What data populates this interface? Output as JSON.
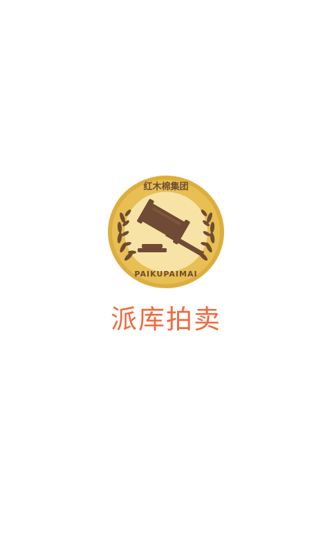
{
  "splash": {
    "logo": {
      "icon": "auction-gavel-icon",
      "top_text": "红木棉集团",
      "bottom_text": "PAIKUPAIMAI"
    },
    "app_name": "派库拍卖"
  },
  "colors": {
    "background": "#ffffff",
    "gold_outer": "#dcae3f",
    "gold_inner": "#f7e3a6",
    "brown": "#6f4a34",
    "app_name": "#ef6a3e"
  }
}
